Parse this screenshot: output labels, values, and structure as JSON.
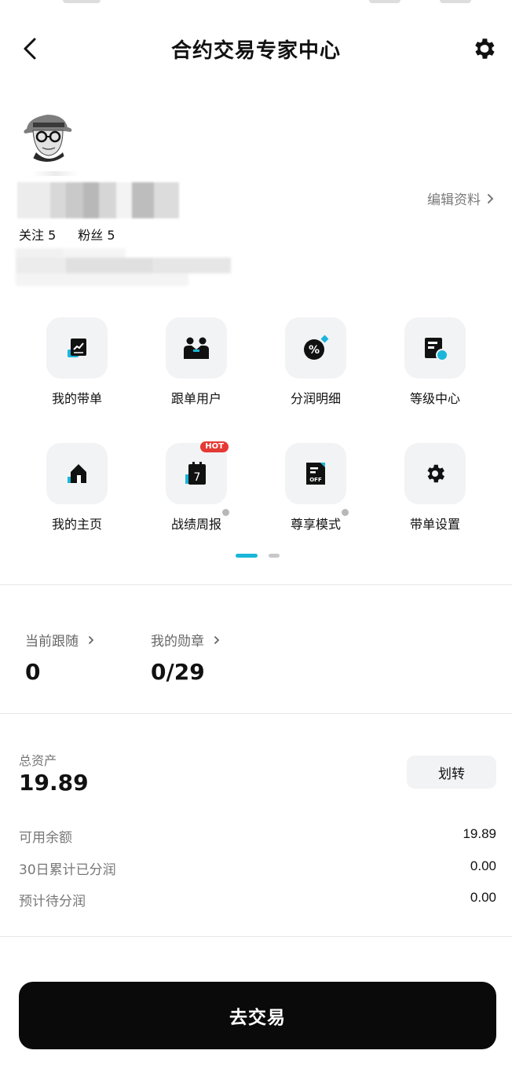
{
  "header": {
    "title": "合约交易专家中心"
  },
  "profile": {
    "edit_label": "编辑资料",
    "follow_label": "关注",
    "follow_count": "5",
    "fans_label": "粉丝",
    "fans_count": "5"
  },
  "menu": {
    "items": [
      {
        "label": "我的带单",
        "icon": "chart-doc-icon"
      },
      {
        "label": "跟单用户",
        "icon": "users-icon"
      },
      {
        "label": "分润明细",
        "icon": "percent-icon"
      },
      {
        "label": "等级中心",
        "icon": "level-doc-icon"
      },
      {
        "label": "我的主页",
        "icon": "home-icon"
      },
      {
        "label": "战绩周报",
        "icon": "calendar-icon",
        "badge": "HOT"
      },
      {
        "label": "尊享模式",
        "icon": "off-doc-icon"
      },
      {
        "label": "带单设置",
        "icon": "gear-icon"
      }
    ]
  },
  "stats": {
    "following_label": "当前跟随",
    "following_value": "0",
    "medals_label": "我的勋章",
    "medals_value": "0/29"
  },
  "assets": {
    "total_label": "总资产",
    "total_value": "19.89",
    "transfer_label": "划转",
    "rows": [
      {
        "label": "可用余额",
        "value": "19.89"
      },
      {
        "label": "30日累计已分润",
        "value": "0.00"
      },
      {
        "label": "预计待分润",
        "value": "0.00"
      }
    ]
  },
  "cta": {
    "label": "去交易"
  },
  "colors": {
    "accent": "#19b6d9",
    "hot": "#e53935",
    "button": "#0a0a0a"
  }
}
